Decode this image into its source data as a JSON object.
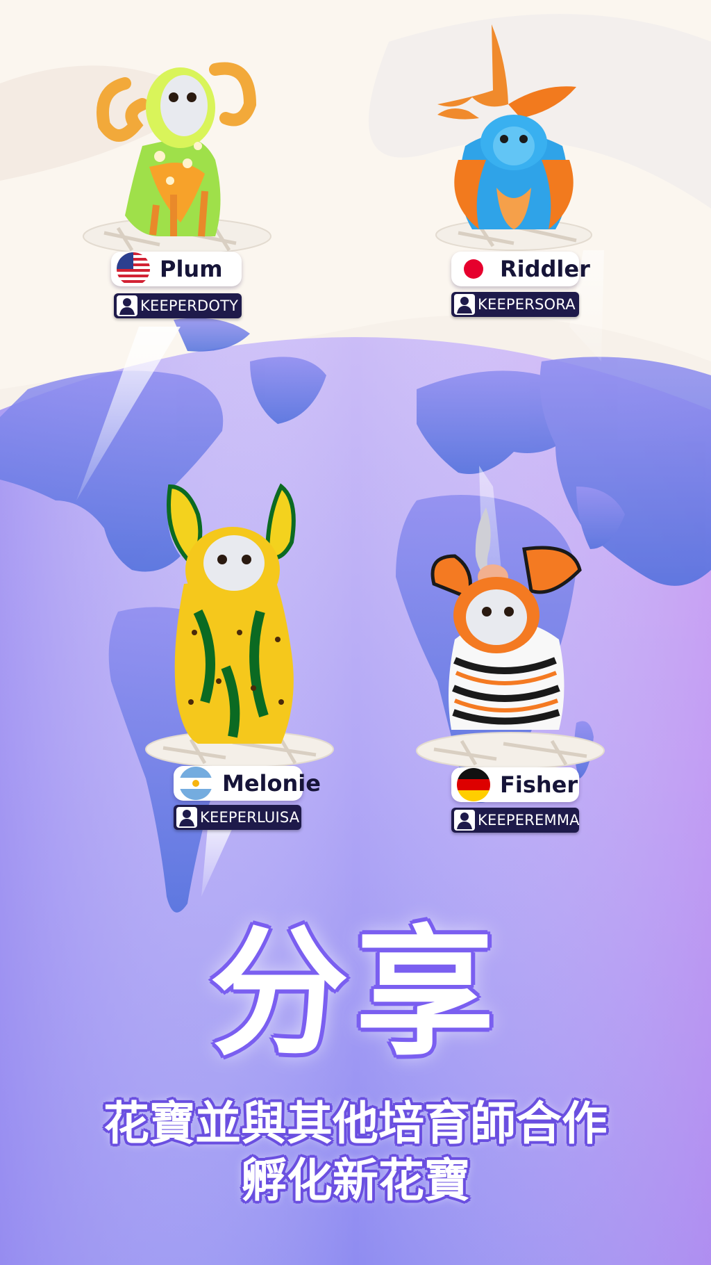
{
  "cards": [
    {
      "id": "plum",
      "name": "Plum",
      "keeper": "KEEPERDOTY",
      "flag": "us-flag-icon"
    },
    {
      "id": "riddler",
      "name": "Riddler",
      "keeper": "KEEPERSORA",
      "flag": "japan-flag-icon"
    },
    {
      "id": "melonie",
      "name": "Melonie",
      "keeper": "KEEPERLUISA",
      "flag": "argentina-flag-icon"
    },
    {
      "id": "fisher",
      "name": "Fisher",
      "keeper": "KEEPEREMMA",
      "flag": "germany-flag-icon"
    }
  ],
  "headline": "分享",
  "subline": [
    "花寶並與其他培育師合作",
    "孵化新花寶"
  ],
  "colors": {
    "globe_top": "#c9b8f6",
    "globe_bottom": "#8f86f0",
    "continents": "#6a78e0",
    "tag_dark": "#1e1a4a",
    "headline_outline": "#7a5ff0"
  }
}
